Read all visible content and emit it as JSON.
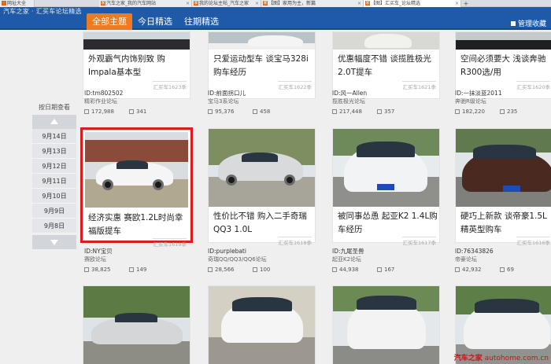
{
  "browser_tabs": [
    {
      "title": "网址大全",
      "active": false
    },
    {
      "title": "汽车之家_我的汽车网站",
      "active": false
    },
    {
      "title": "我的论坛主帖_汽车之家",
      "active": false
    },
    {
      "title": "【图】家用为主，新篇",
      "active": false
    },
    {
      "title": "【图】汇买车_论坛精选",
      "active": true
    }
  ],
  "site_title": "汽车之家 · 汇买车论坛精选",
  "nav": {
    "tabs": [
      "全部主题",
      "今日精选",
      "往期精选"
    ],
    "active_index": 0,
    "manage_label": "管理收藏"
  },
  "date_sidebar": {
    "title": "按日期查看",
    "dates": [
      "9月14日",
      "9月13日",
      "9月12日",
      "9月11日",
      "9月10日",
      "9月9日",
      "9月8日"
    ]
  },
  "colors": {
    "accent": "#f07a1e",
    "nav": "#1e5aa8",
    "selected_outline": "#d91c1c"
  },
  "row1": [
    {
      "title": "外观霸气内饰别致 购Impala基本型",
      "tag": "汇买车1623季",
      "uid": "ID:tm802502",
      "forum": "精彩作业论坛",
      "views": "172,988",
      "replies": "341"
    },
    {
      "title": "只爱运动型车 谈宝马328i购车经历",
      "tag": "汇买车1622季",
      "uid": "ID:前面拐口儿",
      "forum": "宝马3系论坛",
      "views": "95,376",
      "replies": "458"
    },
    {
      "title": "优惠幅度不错 谈揽胜极光2.0T提车",
      "tag": "汇买车1621季",
      "uid": "ID:风一Allen",
      "forum": "揽胜极光论坛",
      "views": "217,448",
      "replies": "357"
    },
    {
      "title": "空间必须要大 浅谈奔驰R300选/用",
      "tag": "汇买车1620季",
      "uid": "ID:一抹淡蓝2011",
      "forum": "奔驰R级论坛",
      "views": "182,220",
      "replies": "235"
    }
  ],
  "row2": [
    {
      "title": "经济实惠 赛欧1.2L时尚幸福版提车",
      "tag": "汇买车1619季",
      "uid": "ID:NY宝贝",
      "forum": "赛欧论坛",
      "views": "38,825",
      "replies": "149",
      "selected": true
    },
    {
      "title": "性价比不错 购入二手奇瑞QQ3 1.0L",
      "tag": "汇买车1618季",
      "uid": "ID:purplebati",
      "forum": "奇瑞QQ/QQ3/QQ6论坛",
      "views": "28,566",
      "replies": "100"
    },
    {
      "title": "被同事怂恿 起亚K2 1.4L购车经历",
      "tag": "汇买车1617季",
      "uid": "ID:九尾圣兽",
      "forum": "起亚K2论坛",
      "views": "44,938",
      "replies": "167"
    },
    {
      "title": "硬巧上新款 谈帝豪1.5L精英型购车",
      "tag": "汇买车1616季",
      "uid": "ID:76343826",
      "forum": "帝豪论坛",
      "views": "42,932",
      "replies": "69"
    }
  ],
  "watermark": {
    "brand": "汽车之家",
    "site": "autohome.com.cn"
  }
}
